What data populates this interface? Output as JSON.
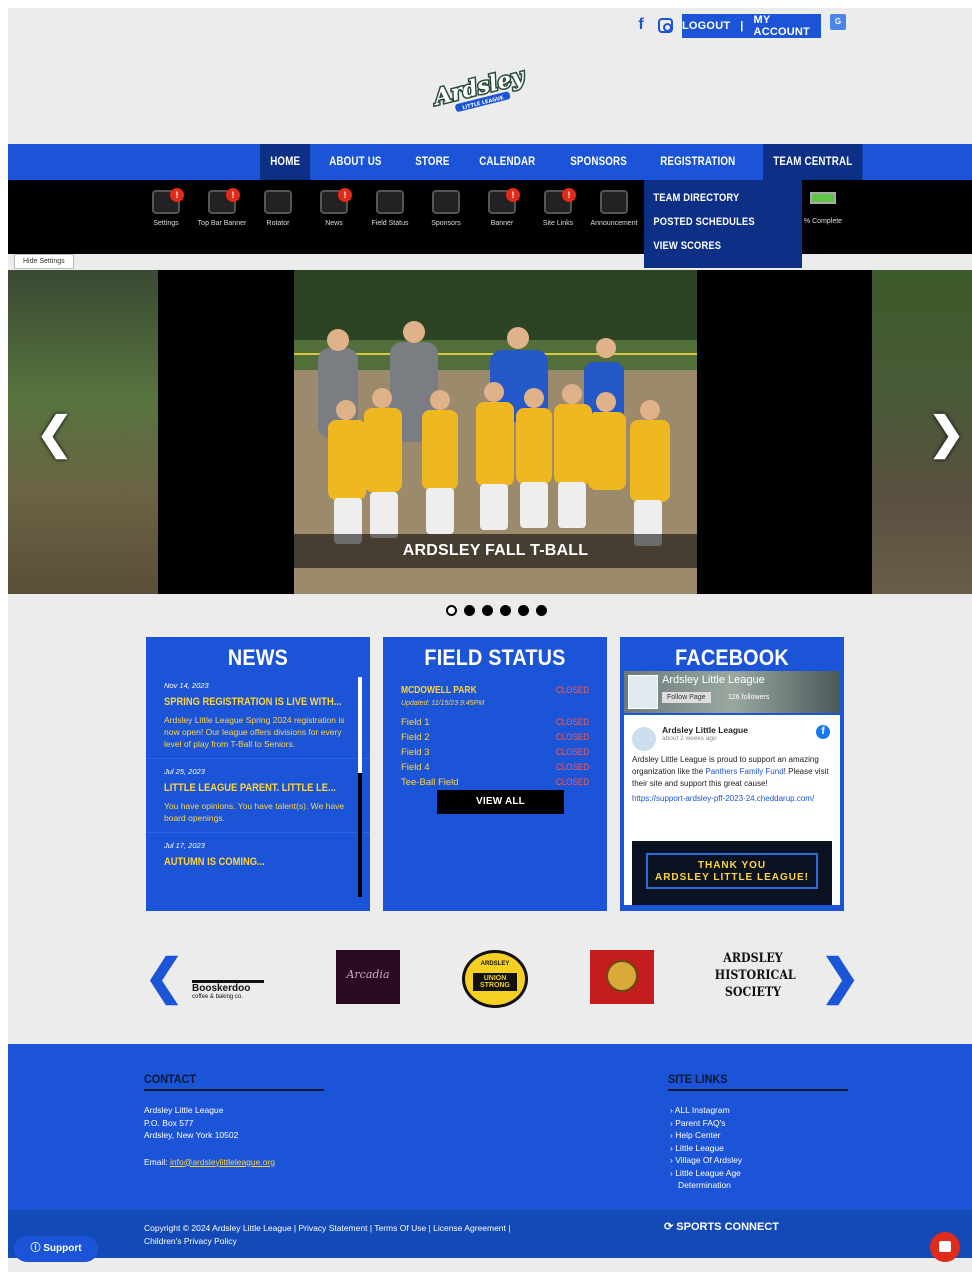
{
  "header": {
    "social": {
      "facebook": "f",
      "instagram": "instagram-icon"
    },
    "account": {
      "logout": "LOGOUT",
      "separator": "|",
      "my_account": "MY ACCOUNT"
    },
    "translate_label": "G",
    "logo_text": "Ardsley",
    "logo_subtext": "LITTLE LEAGUE"
  },
  "nav": {
    "items": [
      "HOME",
      "ABOUT US",
      "STORE",
      "CALENDAR",
      "SPONSORS",
      "REGISTRATION",
      "TEAM CENTRAL"
    ],
    "active": "HOME"
  },
  "settings_bar": {
    "items": [
      {
        "label": "Settings",
        "warn": true
      },
      {
        "label": "Top Bar Banner",
        "warn": true
      },
      {
        "label": "Rotator",
        "warn": false
      },
      {
        "label": "News",
        "warn": true
      },
      {
        "label": "Field Status",
        "warn": false
      },
      {
        "label": "Sponsors",
        "warn": false
      },
      {
        "label": "Banner",
        "warn": true
      },
      {
        "label": "Site Links",
        "warn": true
      },
      {
        "label": "Announcement",
        "warn": false
      }
    ],
    "progress_label": "% Complete",
    "hide_settings": "Hide Settings"
  },
  "team_central_menu": [
    "TEAM DIRECTORY",
    "POSTED SCHEDULES",
    "VIEW SCORES"
  ],
  "slider": {
    "caption": "ARDSLEY FALL T-BALL",
    "prev": "❮",
    "next": "❯",
    "dots": 6,
    "active_dot": 0
  },
  "news": {
    "title": "NEWS",
    "items": [
      {
        "date": "Nov 14, 2023",
        "headline": "SPRING REGISTRATION IS LIVE WITH...",
        "body": "Ardsley Little League Spring 2024 registration is now open! Our league offers divisions for every level of play from T-Ball to Seniors."
      },
      {
        "date": "Jul 25, 2023",
        "headline": "LITTLE LEAGUE PARENT. LITTLE LE...",
        "body": "You have opinions.  You have talent(s). We have board openings."
      },
      {
        "date": "Jul 17, 2023",
        "headline": "AUTUMN IS COMING...",
        "body": ""
      }
    ]
  },
  "field_status": {
    "title": "FIELD STATUS",
    "park": "MCDOWELL PARK",
    "park_status": "CLOSED",
    "updated": "Updated: 11/15/23 9:45PM",
    "fields": [
      {
        "name": "Field 1",
        "status": "CLOSED"
      },
      {
        "name": "Field 2",
        "status": "CLOSED"
      },
      {
        "name": "Field 3",
        "status": "CLOSED"
      },
      {
        "name": "Field 4",
        "status": "CLOSED"
      },
      {
        "name": "Tee-Ball Field",
        "status": "CLOSED"
      }
    ],
    "view_all": "VIEW ALL"
  },
  "facebook": {
    "title": "FACEBOOK",
    "page_name": "Ardsley Little League",
    "follow": "Follow Page",
    "followers": "126 followers",
    "post_author": "Ardsley Little League",
    "post_time": "about 2 weeks ago",
    "post_text_1": "Ardsley Little League is proud to support an amazing organization like the ",
    "post_link_text": "Panthers Family Fund",
    "post_text_2": "! Please visit their site and support this great cause!",
    "post_url": "https://support-ardsley-pff-2023-24.cheddarup.com/",
    "image_line1": "THANK YOU",
    "image_line2": "ARDSLEY LITTLE LEAGUE!"
  },
  "sponsors": {
    "prev": "❮",
    "next": "❯",
    "items": [
      {
        "name": "Booskerdoo",
        "sub": "coffee & baking co."
      },
      {
        "name": "Arcadia",
        "sub": ""
      },
      {
        "name": "ARDSLEY",
        "sub": "UNION STRONG"
      },
      {
        "name": "seal",
        "sub": ""
      },
      {
        "name": "ARDSLEY HISTORICAL SOCIETY",
        "sub": ""
      }
    ]
  },
  "footer": {
    "contact_title": "CONTACT",
    "contact_lines": [
      "Ardsley Little League",
      "P.O. Box 577",
      "Ardsley, New York 10502"
    ],
    "email_label": "Email: ",
    "email": "info@ardsleylittleleague.org",
    "site_links_title": "SITE LINKS",
    "site_links": [
      "ALL Instagram",
      "Parent FAQ's",
      "Help Center",
      "Little League",
      "Village Of Ardsley",
      "Little League Age Determination"
    ],
    "copyright_1": "Copyright © 2024 Ardsley Little League | Privacy Statement | Terms Of Use | License Agreement |",
    "copyright_2": "Children's Privacy Policy",
    "brand": "SPORTS CONNECT",
    "support": "Support"
  },
  "colors": {
    "primary": "#1c54d8",
    "dark_nav": "#0d2f86",
    "accent_yellow": "#ffd43b",
    "closed_red": "#ff5a4a"
  }
}
